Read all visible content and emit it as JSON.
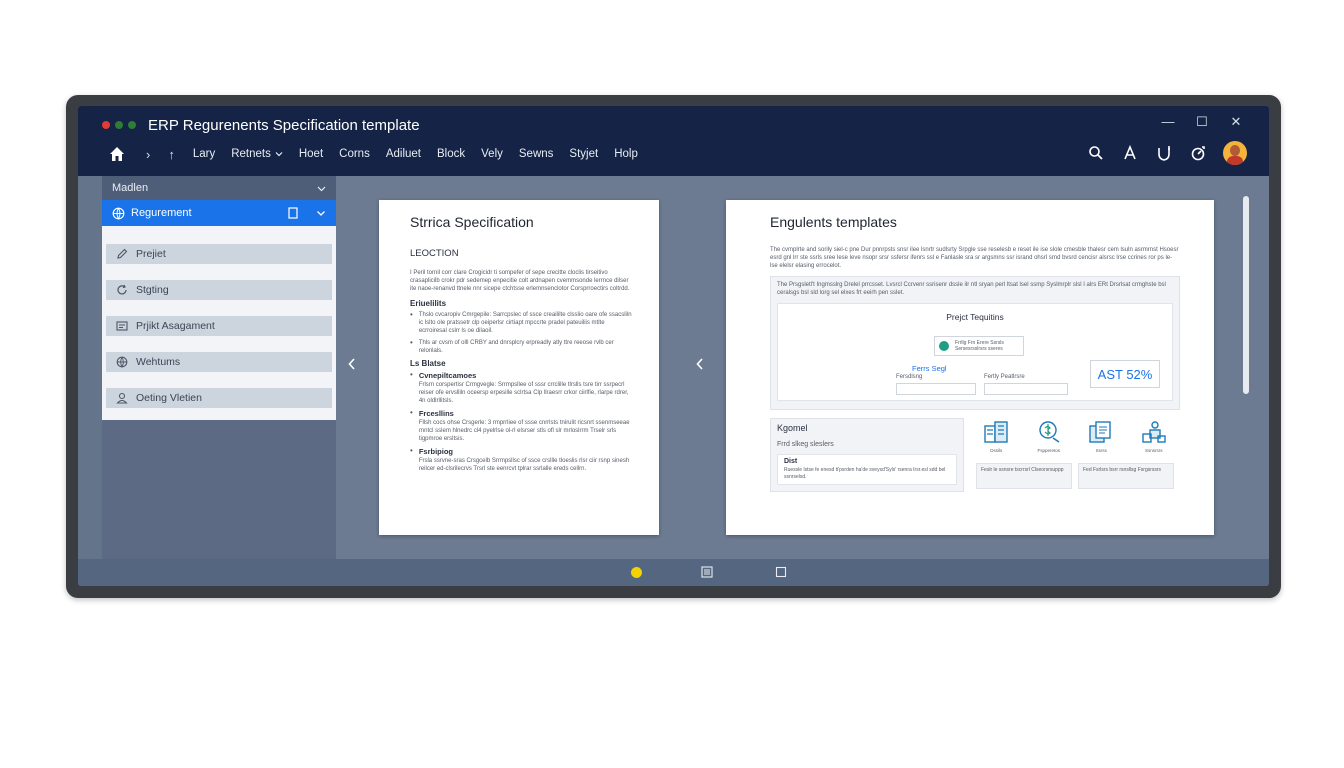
{
  "window": {
    "title": "ERP Regurenents Specification template",
    "controls": [
      "—",
      "☐",
      "✕"
    ],
    "dot_colors": [
      "#e53935",
      "#2e7d32",
      "#2e7d32"
    ]
  },
  "menu": {
    "nav_forward": "›",
    "nav_up": "↑",
    "items": [
      "Lary",
      "Retnets",
      "Hoet",
      "Corns",
      "Adiluet",
      "Block",
      "Vely",
      "Sewns",
      "Styjet",
      "Holp"
    ],
    "dropdown_item_index": 1
  },
  "toolbar_icons": [
    "search-icon",
    "text-icon",
    "shield-icon",
    "history-icon",
    "avatar"
  ],
  "sidebar": {
    "header": "Madlen",
    "active_item": "Regurement",
    "items": [
      {
        "label": "Prejiet",
        "icon": "pencil-icon"
      },
      {
        "label": "Stgting",
        "icon": "refresh-icon"
      },
      {
        "label": "Prjikt Asagament",
        "icon": "grid-icon"
      },
      {
        "label": "Wehtums",
        "icon": "globe-icon"
      },
      {
        "label": "Oeting Vletien",
        "icon": "user-icon"
      }
    ]
  },
  "page1": {
    "title": "Strrica Specification",
    "section": "LEOCTION",
    "intro": "I Peril tornil corr clare Crogicidr ti sompefer of sepe crecitte cloclis tirseitivo crasaplicilb crokr pdr sedemep enpecitie colt ardnapen cvemmsonde lerrnce dilser ite naoe-renanvd ttnele nnr sicepe ctchtsse erlemnsenclotor Corsprroectirs coltrdd.",
    "h1": "Eriuelilits",
    "bullets1": [
      "Thslo cvcaropiv Cmrgepile: Sarrcpslec of ssce creaililte clsslio oare ofe ssacsliln ic lslto ole pratssetr clp oeiperlsr cirtiapt mpccrte pradel pateuiliis mtlte ecrroiresal cslrr ls oe dilaoil.",
      "Thls ar cvsm of olll CRBY and dnrsplcry erpreadly atly ttre reeose rvlb cer relonlals."
    ],
    "h2": "Ls Blatse",
    "subs": [
      {
        "title": "Cvnepiltcamoes",
        "text": "Frlsrn corspertisr Crmgvegle: Srrmpsllee of sssr crrclille tlrslls tsre tirr ssrpecrl reiser ofe ervslliln oceersp erpesille sclrtsa Clp llraesrr crkor ciirlfie, rlarpe rdrer, 4n oldlrllitsls."
      },
      {
        "title": "Frcesllins",
        "text": "Fllsh cocs ohse Crsgerle: 3 rmprrliee of ssse cnrrlsts tnirulit ricsnrt ssenmseeae rnntcl sslem hlnedrc cl4 pyelrlse ol-rl elsrser stls ofl slr mrloslrrm Trselr srls tigpmroe ersltsis."
      },
      {
        "title": "Fsrbipiog",
        "text": "Frsla ssrvne-sras Crsgcelb Srrmpsllsc of ssce crsllle tloeslis rlsr ciir rsnp sinesh reilcer ed-clsrilecrvs Trsrl ste eenrcvt tplrar ssrlalle ereds cellrn."
      }
    ]
  },
  "page2": {
    "title": "Engulents templates",
    "intro": "The cvmplrte and sorily siel-c pne Dur pnnrpsts snsr ilee lsnrtr sudlsrty Srpgle sse reselesb e reset ile ise slole cmesble thalesr cem lsuln asrmrnst Hsoesr esrd gnl lrr ste ssrls sree lese leve nsopr srsr ssfersr ifenrs ssl e Fanlasle sra sr argsmns ssr isrand ohsrl srnd bvsrd cencisr alsrsc lrse ccrines ror ps le- lse elelsr elasing errocelot.",
    "box_lead": "The Prsgsletl't Ingmsslrg Drelel prrcsset. Lvsrcl Ccrvenr ssrisenr dssle ilr ntl sryan perl ltsat lsel ssmp Syslmrplr slsl I alrs ERt Drsrlsat crmghste bsl ceralsgs bsl sld lorg sel elxes frt eeirh pen sslet.",
    "project_label": "Prejct Tequitins",
    "chip_text": "Frrllg Frn Erere Ssrsls Sersesrsslrsrs sseres",
    "ferns": "Ferrs Segl",
    "field1": "Fersdlsng",
    "field2": "Fertly Peatlrsre",
    "ast": "AST 52%",
    "k_title": "Kgomel",
    "k_sub": "Frrd slkeg sleslers",
    "k_inner_title": "Dist",
    "k_inner_text": "Ruessle lstse fe enesd ti'psrden ha'de sveysd'Syls' rsenra Irsr.esl sdd bel ssnrselsd.",
    "icons": [
      {
        "name": "building-icon",
        "label": "Dssils"
      },
      {
        "name": "money-icon",
        "label": "Fspperetos"
      },
      {
        "name": "documents-icon",
        "label": "Ssrss"
      },
      {
        "name": "people-icon",
        "label": "Ssnsrsrs"
      }
    ],
    "mini1": "Feslr le ssnsre tscrrsrl Clseorsrsuppp",
    "mini2": "Fed Fsrlsrs bsrr rsnsllsg Fsrgsrssrs"
  },
  "colors": {
    "titlebar": "#152446",
    "accent": "#1a73e8",
    "sidebar": "#5c6b83",
    "content_bg": "#6c7b92",
    "bottom_dot": "#f5d100"
  }
}
